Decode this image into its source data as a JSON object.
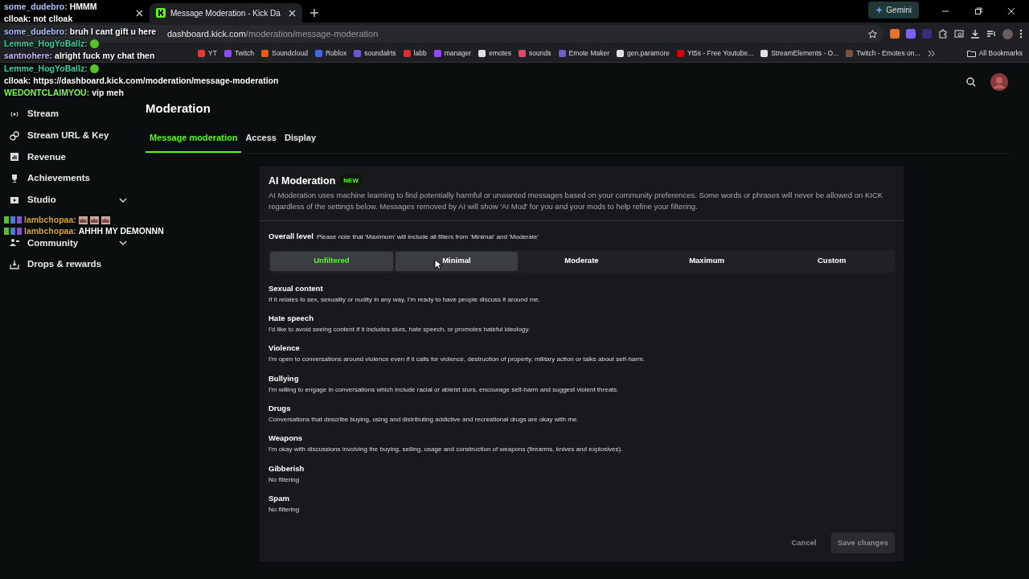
{
  "browser": {
    "tabs": [
      {
        "selected": false
      },
      {
        "title": "Message Moderation - Kick Da",
        "selected": true
      }
    ],
    "gemini": "Gemini",
    "url": {
      "host": "dashboard.kick.com",
      "path": "/moderation/message-moderation"
    },
    "bookmarks": [
      {
        "label": "YT",
        "color": "#e53935"
      },
      {
        "label": "Twitch",
        "color": "#9146ff"
      },
      {
        "label": "Soundcloud",
        "color": "#ff5500"
      },
      {
        "label": "Roblox",
        "color": "#3d6ae0"
      },
      {
        "label": "soundalrts",
        "color": "#6a5acd"
      },
      {
        "label": "labb",
        "color": "#d32f2f"
      },
      {
        "label": "manager",
        "color": "#9146ff"
      },
      {
        "label": "emotes",
        "color": "#e0e0e0"
      },
      {
        "label": "sounds",
        "color": "#e5485f"
      },
      {
        "label": "Emote Maker",
        "color": "#6e5bd6"
      },
      {
        "label": "gen.paramore",
        "color": "#e0e0e0"
      },
      {
        "label": "Yt5s - Free Youtube...",
        "color": "#d50000"
      },
      {
        "label": "StreamElements - O...",
        "color": "#e0e0e0"
      },
      {
        "label": "Twitch - Emotes on...",
        "color": "#7a5040"
      }
    ],
    "all_bookmarks": "All Bookmarks"
  },
  "chat": [
    {
      "user": "some_dudebro:",
      "color": "#a9c4ff",
      "kind": "text",
      "message": "HMMM"
    },
    {
      "user": "clloak:",
      "color": "#ffffff",
      "kind": "text",
      "message": "not clloak"
    },
    {
      "user": "some_dudebro:",
      "color": "#a9c4ff",
      "kind": "text",
      "message": "bruh I cant gift u here"
    },
    {
      "user": "Lemme_HogYoBallz:",
      "color": "#3ad1a0",
      "kind": "emote"
    },
    {
      "user": "santnohere:",
      "color": "#c9b8ff",
      "kind": "text",
      "message": "alright fuck my chat then"
    },
    {
      "user": "Lemme_HogYoBallz:",
      "color": "#3ad1a0",
      "kind": "emote"
    },
    {
      "user": "clloak:",
      "color": "#ffffff",
      "kind": "text",
      "message": "https://dashboard.kick.com/moderation/message-moderation"
    },
    {
      "user": "WEDONTCLAIMYOU:",
      "color": "#7cfc5a",
      "kind": "text",
      "message": "vip meh"
    }
  ],
  "chat_lower": [
    {
      "user": "lambchopaa:",
      "color": "#d9a62e",
      "kind": "emotes"
    },
    {
      "user": "lambchopaa:",
      "color": "#d9a62e",
      "kind": "text",
      "message": "AHHH MY DEMONNN"
    }
  ],
  "sidebar": [
    {
      "label": "Stream",
      "chevron": false
    },
    {
      "label": "Stream URL & Key",
      "chevron": false
    },
    {
      "label": "Revenue",
      "chevron": false
    },
    {
      "label": "Achievements",
      "chevron": false
    },
    {
      "label": "Studio",
      "chevron": true
    },
    {
      "label": "Community",
      "chevron": true
    },
    {
      "label": "Drops & rewards",
      "chevron": false
    }
  ],
  "page_title": "Moderation",
  "tabs": [
    {
      "label": "Message moderation",
      "selected": true
    },
    {
      "label": "Access",
      "selected": false
    },
    {
      "label": "Display",
      "selected": false
    }
  ],
  "panel": {
    "title": "AI Moderation",
    "badge": "NEW",
    "description": "AI Moderation uses machine learning to find potentially harmful or unwanted messages based on your community preferences. Some words or phrases will never be allowed on KICK regardless of the settings below. Messages removed by AI will show 'AI Mod' for you and your mods to help refine your filtering.",
    "overall_label": "Overall level",
    "overall_note": "Please note that 'Maximum' will include all filters from 'Minimal' and 'Moderate'",
    "levels": [
      {
        "label": "Unfiltered",
        "selected": true,
        "hovered": false
      },
      {
        "label": "Minimal",
        "selected": false,
        "hovered": true
      },
      {
        "label": "Moderate",
        "selected": false,
        "hovered": false
      },
      {
        "label": "Maximum",
        "selected": false,
        "hovered": false
      },
      {
        "label": "Custom",
        "selected": false,
        "hovered": false
      }
    ],
    "categories": [
      {
        "title": "Sexual content",
        "text": "If it relates to sex, sexuality or nudity in any way, I'm ready to have people discuss it around me."
      },
      {
        "title": "Hate speech",
        "text": "I'd like to avoid seeing content if it includes slurs, hate speech, or promotes hateful ideology."
      },
      {
        "title": "Violence",
        "text": "I'm open to conversations around violence even if it calls for violence, destruction of property, military action or talks about self-harm."
      },
      {
        "title": "Bullying",
        "text": "I'm willing to engage in conversations which include racial or ableist slurs, encourage self-harm and suggest violent threats."
      },
      {
        "title": "Drugs",
        "text": "Conversations that describe buying, using and distributing addictive and recreational drugs are okay with me."
      },
      {
        "title": "Weapons",
        "text": "I'm okay with discussions involving the buying, selling, usage and construction of weapons (firearms, knives and explosives)."
      },
      {
        "title": "Gibberish",
        "text": "No filtering"
      },
      {
        "title": "Spam",
        "text": "No filtering"
      }
    ],
    "buttons": [
      {
        "label": "Cancel",
        "kind": "secondary",
        "disabled": true
      },
      {
        "label": "Save changes",
        "kind": "primary",
        "disabled": true
      }
    ]
  }
}
